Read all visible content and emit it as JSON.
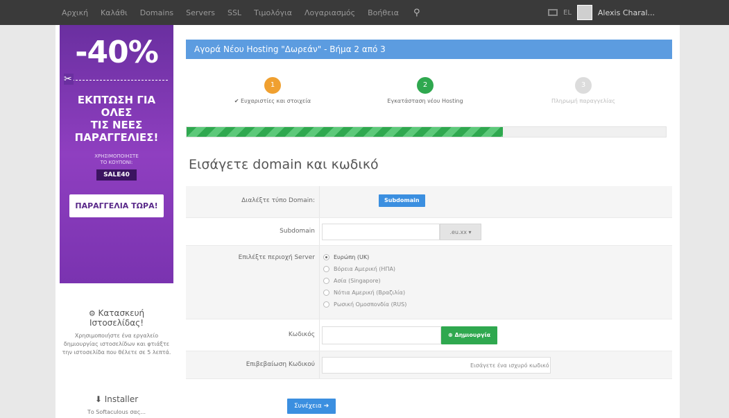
{
  "navbar": {
    "items": [
      "Αρχική",
      "Καλάθι",
      "Domains",
      "Servers",
      "SSL",
      "Τιμολόγια",
      "Λογαριασμός",
      "Βοήθεια"
    ],
    "language": "EL",
    "user": "Alexis Charal..."
  },
  "promo": {
    "discount": "-40%",
    "headline_1": "ΕΚΠΤΩΣΗ ΓΙΑ",
    "headline_2": "ΟΛΕΣ",
    "headline_3": "ΤΙΣ ΝΕΕΣ",
    "headline_4": "ΠΑΡΑΓΓΕΛΙΕΣ!",
    "note_1": "ΧΡΗΣΙΜΟΠΟΙΗΣΤΕ",
    "note_2": "ΤΟ ΚΟΥΠΟΝΙ:",
    "code": "SALE40",
    "button": "ΠΑΡΑΓΓΕΛΙΑ ΤΩΡΑ!"
  },
  "sidebar": {
    "builder_title_1": "Κατασκευή",
    "builder_title_2": "Ιστοσελίδας!",
    "builder_desc": "Χρησιμοποιήστε ένα εργαλείο δημιουργίας ιστοσελίδων και φτιάξτε την ιστοσελίδα που θέλετε σε 5 λεπτά.",
    "installer_title": "Installer",
    "installer_desc": "Το Softaculous σας..."
  },
  "main": {
    "header": "Αγορά Νέου Hosting \"Δωρεάν\" - Βήμα 2 από 3",
    "steps": [
      {
        "number": "1",
        "label": "✔ Ευχαριστίες και στοιχεία",
        "color": "#f0a030"
      },
      {
        "number": "2",
        "label": "Εγκατάσταση νέου Hosting",
        "color": "#2fa84f"
      },
      {
        "number": "3",
        "label": "Πληρωμή παραγγελίας",
        "color": "#dcdcdc"
      }
    ],
    "progress_fraction": 0.66,
    "form_title": "Εισάγετε domain και κωδικό",
    "rows": {
      "domain_type_label": "Διαλέξτε τύπο Domain:",
      "domain_type_button": "Subdomain",
      "subdomain_label": "Subdomain",
      "subdomain_addon": ".eu.xx ▾",
      "server_label": "Επιλέξτε περιοχή Server",
      "servers": [
        "Ευρώπη (UK)",
        "Βόρεια Αμερική (ΗΠΑ)",
        "Ασία (Singapore)",
        "Νότια Αμερική (Βραζιλία)",
        "Ρωσική Ομοσπονδία (RUS)"
      ],
      "password_label": "Κωδικός",
      "generate_button": "Δημιουργία",
      "confirm_label": "Επιβεβαίωση Κωδικού",
      "confirm_hint": "Εισάγετε ένα ισχυρό κωδικό"
    },
    "submit": "Συνέχεια ➔"
  }
}
